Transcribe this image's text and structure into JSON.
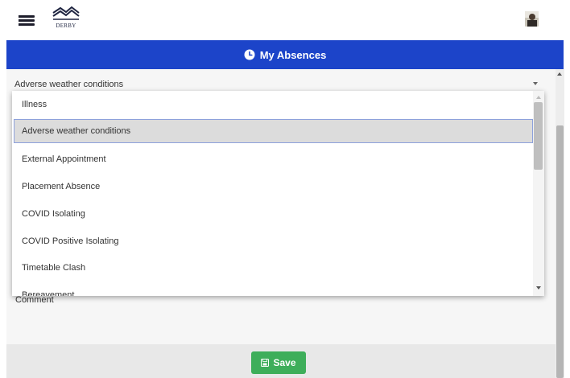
{
  "app": {
    "logo_text": "DERBY",
    "menu_icon": "hamburger-icon",
    "avatar_icon": "user-avatar"
  },
  "header": {
    "title": "My Absences",
    "icon": "clock-icon",
    "color": "#1c44c9"
  },
  "form": {
    "reason_select": {
      "selected_value": "Adverse weather conditions",
      "options": [
        "Illness",
        "Adverse weather conditions",
        "External Appointment",
        "Placement Absence",
        "COVID Isolating",
        "COVID Positive Isolating",
        "Timetable Clash",
        "Bereavement"
      ]
    },
    "comment_label": "Comment",
    "save_label": "Save",
    "save_icon": "save-icon",
    "save_color": "#3eae5a"
  }
}
